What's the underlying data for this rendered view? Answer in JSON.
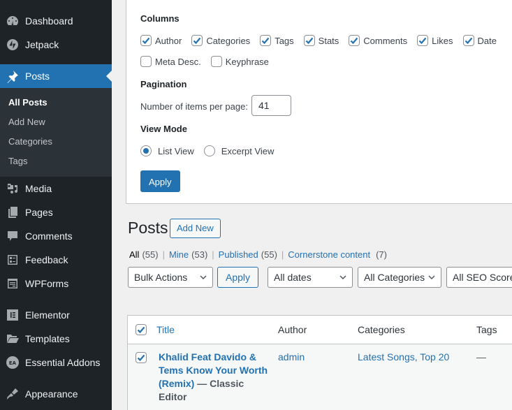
{
  "sidebar": {
    "items": [
      {
        "label": "Dashboard",
        "icon": "dashboard-icon"
      },
      {
        "label": "Jetpack",
        "icon": "jetpack-icon"
      },
      {
        "label": "Posts",
        "icon": "pushpin-icon",
        "active": true
      },
      {
        "label": "Media",
        "icon": "media-icon"
      },
      {
        "label": "Pages",
        "icon": "pages-icon"
      },
      {
        "label": "Comments",
        "icon": "comment-bubble-icon"
      },
      {
        "label": "Feedback",
        "icon": "feedback-icon"
      },
      {
        "label": "WPForms",
        "icon": "wpforms-icon"
      },
      {
        "label": "Elementor",
        "icon": "elementor-icon"
      },
      {
        "label": "Templates",
        "icon": "folder-icon"
      },
      {
        "label": "Essential Addons",
        "icon": "essential-addons-icon"
      },
      {
        "label": "Appearance",
        "icon": "paintbrush-icon"
      }
    ],
    "submenu": [
      {
        "label": "All Posts",
        "current": true
      },
      {
        "label": "Add New"
      },
      {
        "label": "Categories"
      },
      {
        "label": "Tags"
      }
    ]
  },
  "screen_options": {
    "columns_heading": "Columns",
    "columns": [
      {
        "label": "Author",
        "checked": true
      },
      {
        "label": "Categories",
        "checked": true
      },
      {
        "label": "Tags",
        "checked": true
      },
      {
        "label": "Stats",
        "checked": true
      },
      {
        "label": "Comments",
        "checked": true
      },
      {
        "label": "Likes",
        "checked": true
      },
      {
        "label": "Date",
        "checked": true
      },
      {
        "label": "Meta Desc.",
        "checked": false
      },
      {
        "label": "Keyphrase",
        "checked": false
      }
    ],
    "pagination_heading": "Pagination",
    "items_per_page_label": "Number of items per page:",
    "items_per_page_value": "41",
    "view_mode_heading": "View Mode",
    "view_modes": [
      {
        "label": "List View",
        "selected": true
      },
      {
        "label": "Excerpt View",
        "selected": false
      }
    ],
    "apply_label": "Apply"
  },
  "posts": {
    "title": "Posts",
    "add_new_label": "Add New",
    "filters": [
      {
        "label": "All",
        "count": "(55)",
        "current": true
      },
      {
        "label": "Mine",
        "count": "(53)"
      },
      {
        "label": "Published",
        "count": "(55)"
      },
      {
        "label": "Cornerstone content",
        "count": "(7)"
      }
    ],
    "bulk_actions": "Bulk Actions",
    "apply_label": "Apply",
    "date_filter": "All dates",
    "category_filter": "All Categories",
    "seo_filter": "All SEO Scores",
    "table": {
      "headers": {
        "title": "Title",
        "author": "Author",
        "categories": "Categories",
        "tags": "Tags"
      },
      "header_checked": true,
      "rows": [
        {
          "checked": true,
          "title": "Khalid Feat Davido & Tems Know Your Worth (Remix)",
          "state": " — Classic Editor",
          "author": "admin",
          "categories": "Latest Songs, Top 20",
          "tags": "—"
        }
      ]
    }
  },
  "colors": {
    "accent": "#2271b1",
    "sidebar_bg": "#1d2327",
    "submenu_bg": "#2c3338",
    "page_bg": "#f0f0f1"
  }
}
